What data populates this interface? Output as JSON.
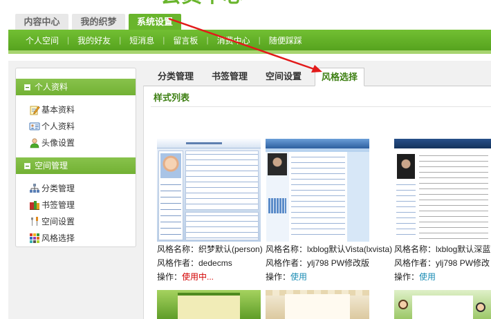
{
  "header": {
    "title": "会员中心"
  },
  "top_tabs": [
    {
      "label": "内容中心"
    },
    {
      "label": "我的织梦"
    },
    {
      "label": "系统设置",
      "active": true
    }
  ],
  "nav": {
    "divider": "|",
    "items": [
      "个人空间",
      "我的好友",
      "短消息",
      "留言板",
      "消费中心",
      "随便踩踩"
    ]
  },
  "sidebar": {
    "groups": [
      {
        "title": "个人资料",
        "expanded": true,
        "items": [
          {
            "label": "基本资料",
            "icon": "edit-note-icon"
          },
          {
            "label": "个人资料",
            "icon": "id-card-icon"
          },
          {
            "label": "头像设置",
            "icon": "user-avatar-icon"
          }
        ]
      },
      {
        "title": "空间管理",
        "expanded": true,
        "items": [
          {
            "label": "分类管理",
            "icon": "category-tree-icon"
          },
          {
            "label": "书签管理",
            "icon": "bookmark-books-icon"
          },
          {
            "label": "空间设置",
            "icon": "tools-icon"
          },
          {
            "label": "风格选择",
            "icon": "color-grid-icon"
          }
        ]
      }
    ]
  },
  "content_tabs": [
    {
      "label": "分类管理"
    },
    {
      "label": "书签管理"
    },
    {
      "label": "空间设置"
    },
    {
      "label": "风格选择",
      "active": true
    }
  ],
  "panel": {
    "title": "样式列表"
  },
  "styles": [
    {
      "name": "风格名称：织梦默认(person)",
      "author": "风格作者：dedecms",
      "action_label": "操作：",
      "action": "使用中..."
    },
    {
      "name": "风格名称：lxblog默认Vista(lxvista)",
      "author": "风格作者：ylj798 PW修改版",
      "action_label": "操作：",
      "action": "使用"
    },
    {
      "name": "风格名称：lxblog默认深蓝",
      "author": "风格作者：ylj798 PW修改",
      "action_label": "操作：",
      "action": "使用"
    }
  ],
  "colors": {
    "brand_green": "#69b52c",
    "nav_green": "#56a31e",
    "sidebar_header_green": "#72b134",
    "title_green": "#3d7f12",
    "status_red": "#d30000",
    "link_blue": "#1a8cb4",
    "annotation_red": "#e21a1a"
  }
}
